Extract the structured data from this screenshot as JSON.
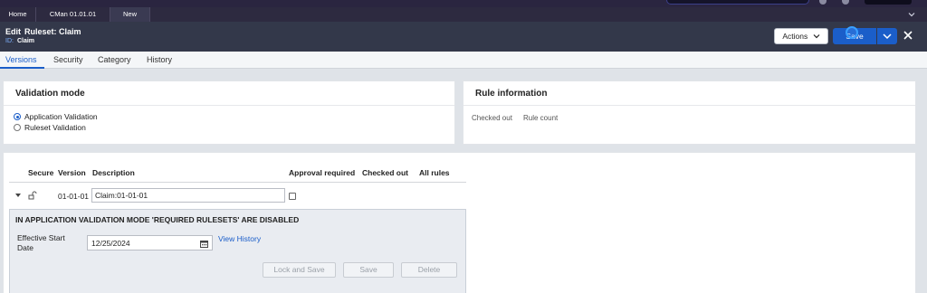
{
  "header": {
    "edit_label": "Edit",
    "title": "Ruleset: Claim",
    "id_label": "ID:",
    "id_value": "Claim",
    "actions_label": "Actions",
    "save_label": "Save"
  },
  "tabs": [
    {
      "label": "Home"
    },
    {
      "label": "CMan 01.01.01"
    },
    {
      "label": "New"
    }
  ],
  "subtabs": [
    {
      "label": "Versions"
    },
    {
      "label": "Security"
    },
    {
      "label": "Category"
    },
    {
      "label": "History"
    }
  ],
  "validation": {
    "title": "Validation mode",
    "options": [
      {
        "label": "Application Validation",
        "selected": true
      },
      {
        "label": "Ruleset Validation",
        "selected": false
      }
    ]
  },
  "rule_info": {
    "title": "Rule information",
    "checked_out": "Checked out",
    "rule_count": "Rule count"
  },
  "table": {
    "headers": {
      "secure": "Secure",
      "version": "Version",
      "description": "Description",
      "approval": "Approval required",
      "checked_out": "Checked out",
      "all_rules": "All rules"
    },
    "row": {
      "version": "01-01-01",
      "description": "Claim:01-01-01"
    }
  },
  "panel": {
    "message": "IN APPLICATION VALIDATION MODE 'REQUIRED RULESETS' ARE DISABLED",
    "esd_label": "Effective Start Date",
    "date_value": "12/25/2024",
    "view_history": "View History",
    "lock_save": "Lock and Save",
    "save": "Save",
    "delete": "Delete"
  },
  "colors": {
    "accent": "#1b5ec9",
    "header_bg": "#33384a"
  }
}
